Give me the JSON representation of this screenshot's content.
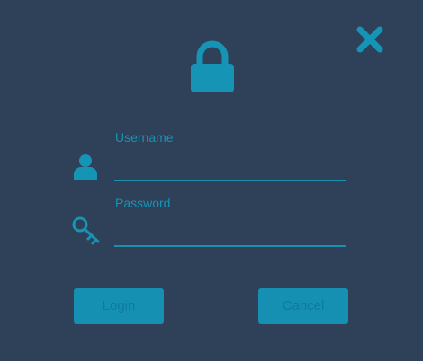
{
  "dialog": {
    "username": {
      "label": "Username",
      "value": "",
      "icon": "user-icon"
    },
    "password": {
      "label": "Password",
      "value": "",
      "icon": "key-icon"
    },
    "login_label": "Login",
    "cancel_label": "Cancel",
    "header_icon": "lock-icon",
    "close_icon": "close-icon",
    "colors": {
      "background": "#2f4059",
      "accent": "#1594b5"
    }
  }
}
